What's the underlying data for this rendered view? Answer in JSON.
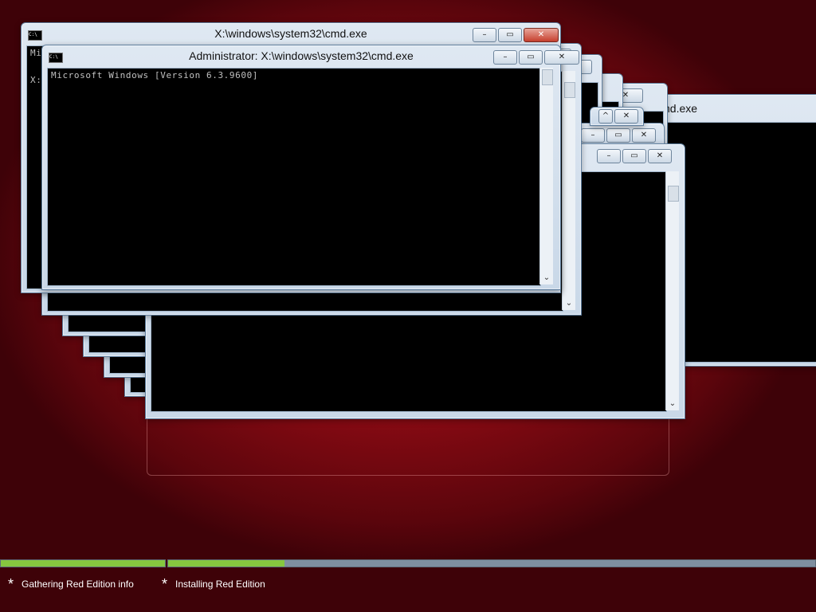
{
  "windows": {
    "front_title": "Administrator: X:\\windows\\system32\\cmd.exe",
    "back_title": "X:\\windows\\system32\\cmd.exe",
    "right_title_partial": "m32\\cmd.exe",
    "console_line": "Microsoft Windows [Version 6.3.9600]",
    "back_console_prefix_1": "Mi",
    "back_console_prefix_2": "X:"
  },
  "caption_buttons": {
    "minimize": "–",
    "maximize": "▭",
    "close": "✕"
  },
  "progress": {
    "steps": [
      {
        "label": "Gathering Red Edition info",
        "progress": 1.0,
        "icon": "asterisk-icon"
      },
      {
        "label": "Installing Red Edition",
        "progress": 0.18,
        "icon": "asterisk-icon"
      }
    ]
  },
  "icons": {
    "cmd": "cmd-icon",
    "scroll_down": "⌄"
  },
  "colors": {
    "accent_progress": "#86c73f",
    "desktop_red": "#a10f18"
  }
}
